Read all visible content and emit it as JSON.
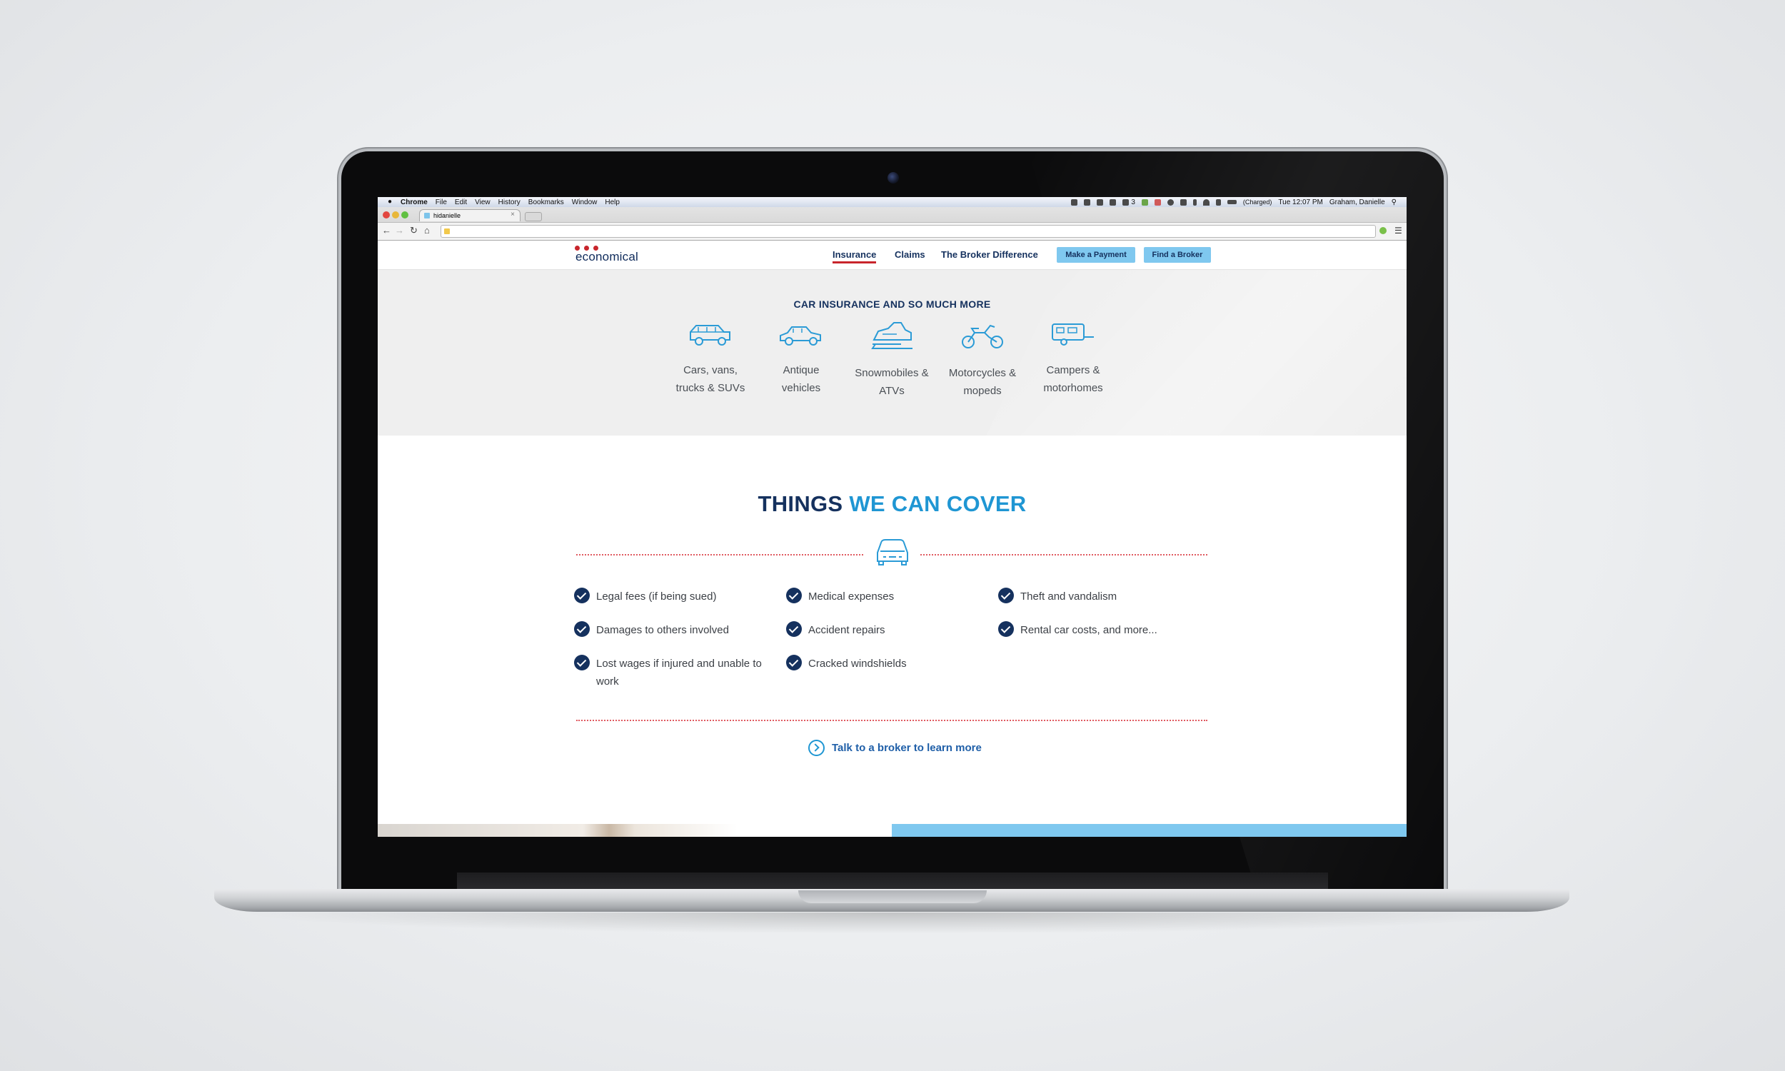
{
  "menubar": {
    "app": "Chrome",
    "items": [
      "File",
      "Edit",
      "View",
      "History",
      "Bookmarks",
      "Window",
      "Help"
    ],
    "status_icon_text": "3",
    "battery": "(Charged)",
    "clock": "Tue 12:07 PM",
    "user": "Graham, Danielle"
  },
  "browser": {
    "tab_title": "hidanielle",
    "tab_close": "×",
    "address": ""
  },
  "site": {
    "logo": "economical",
    "nav": [
      "Insurance",
      "Claims",
      "The Broker Difference"
    ],
    "buttons": {
      "payment": "Make a Payment",
      "broker": "Find a Broker"
    },
    "hero": {
      "title": "CAR INSURANCE AND SO MUCH MORE",
      "vehicles": [
        {
          "label": "Cars, vans,\ntrucks & SUVs",
          "icon": "suv-icon"
        },
        {
          "label": "Antique\nvehicles",
          "icon": "antique-car-icon"
        },
        {
          "label": "Snowmobiles &\nATVs",
          "icon": "snowmobile-icon"
        },
        {
          "label": "Motorcycles &\nmopeds",
          "icon": "motorcycle-icon"
        },
        {
          "label": "Campers &\nmotorhomes",
          "icon": "camper-icon"
        }
      ]
    },
    "cover": {
      "title_a": "THINGS",
      "title_b": "WE CAN COVER",
      "items": [
        "Legal fees (if being sued)",
        "Damages to others involved",
        "Lost wages if injured and unable to work",
        "Medical expenses",
        "Accident repairs",
        "Cracked windshields",
        "Theft and vandalism",
        "Rental car costs, and more..."
      ],
      "cta": "Talk to a broker to learn more"
    }
  },
  "colors": {
    "navy": "#15315e",
    "blue": "#1f96d3",
    "light_blue": "#7fc8ef",
    "red": "#c8252c"
  }
}
